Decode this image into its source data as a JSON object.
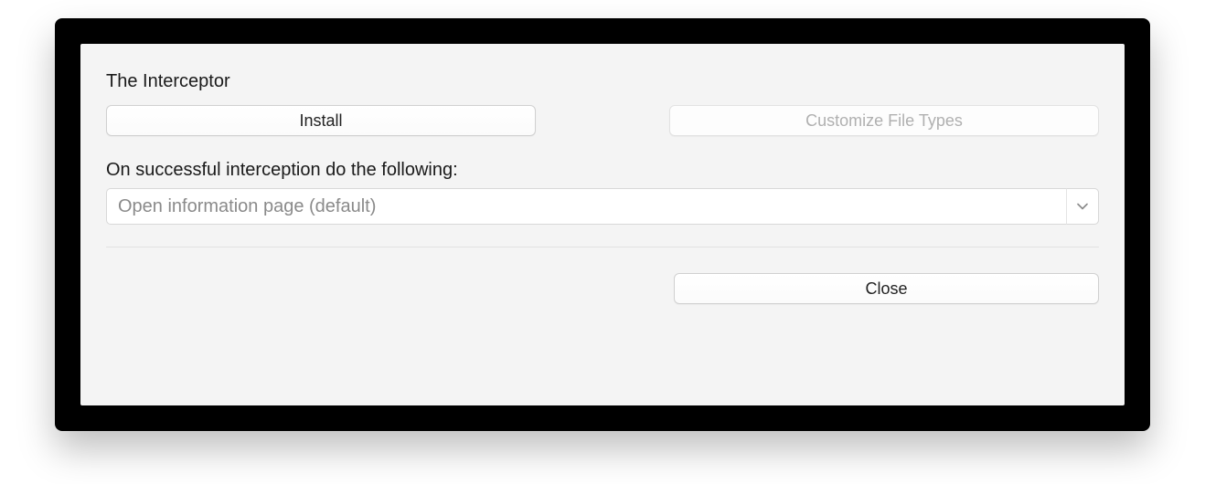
{
  "header": {
    "title": "The Interceptor"
  },
  "buttons": {
    "install_label": "Install",
    "customize_label": "Customize File Types",
    "close_label": "Close"
  },
  "interception": {
    "prompt": "On successful interception do the following:",
    "selected_option": "Open information page (default)"
  }
}
